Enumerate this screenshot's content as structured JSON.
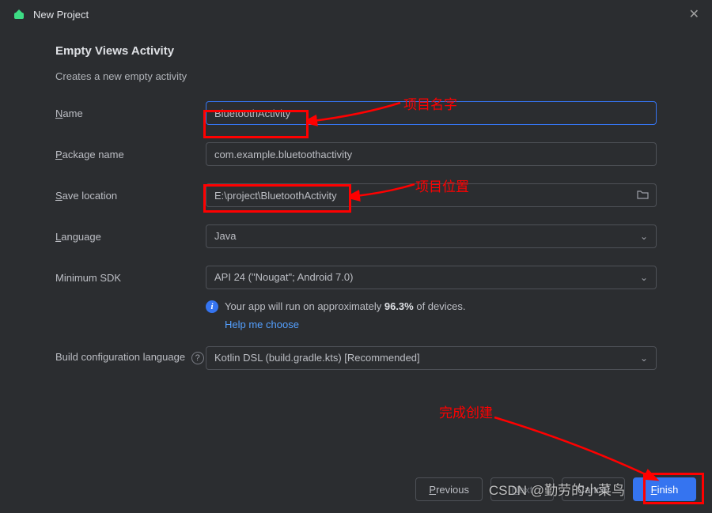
{
  "window": {
    "title": "New Project"
  },
  "header": {
    "heading": "Empty Views Activity",
    "subtitle": "Creates a new empty activity"
  },
  "labels": {
    "name_u": "N",
    "name_rest": "ame",
    "pkg_u": "P",
    "pkg_rest": "ackage name",
    "save_u": "S",
    "save_rest": "ave location",
    "lang_u": "L",
    "lang_rest": "anguage",
    "minsdk": "Minimum SDK",
    "buildcfg": "Build configuration language"
  },
  "fields": {
    "name": "BluetoothActivity",
    "package": "com.example.bluetoothactivity",
    "save": "E:\\project\\BluetoothActivity",
    "language": "Java",
    "minsdk": "API 24 (\"Nougat\"; Android 7.0)",
    "buildcfg": "Kotlin DSL (build.gradle.kts) [Recommended]"
  },
  "info": {
    "text_before": "Your app will run on approximately ",
    "percent": "96.3%",
    "text_after": " of devices.",
    "help": "Help me choose"
  },
  "buttons": {
    "previous_u": "P",
    "previous_rest": "revious",
    "next_u": "N",
    "next_rest": "ext",
    "cancel": "Cancel",
    "finish_u": "F",
    "finish_rest": "inish"
  },
  "annotations": {
    "proj_name": "项目名字",
    "proj_loc": "项目位置",
    "finish_create": "完成创建"
  },
  "watermark": "CSDN @勤劳的小菜鸟"
}
